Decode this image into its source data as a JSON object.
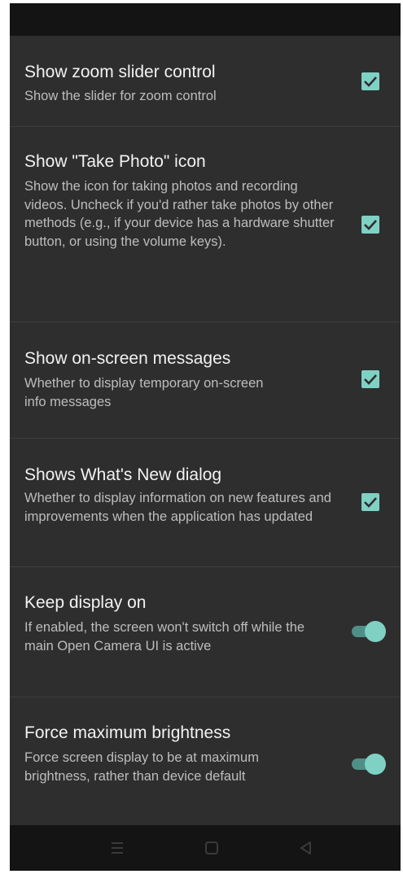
{
  "preferences": [
    {
      "title": "Show zoom slider control",
      "summary": "Show the slider for zoom control",
      "control": "checkbox",
      "checked": true
    },
    {
      "title": "Show \"Take Photo\" icon",
      "summary": "Show the icon for taking photos and recording videos. Uncheck if you'd rather take photos by other methods (e.g., if your device has a hardware shutter button, or using the volume keys).",
      "control": "checkbox",
      "checked": true
    },
    {
      "title": "Show on-screen messages",
      "summary": "Whether to display temporary on-screen info messages",
      "control": "checkbox",
      "checked": true
    },
    {
      "title": "Shows What's New dialog",
      "summary": "Whether to display information on new features and improvements when the application has updated",
      "control": "checkbox",
      "checked": true
    },
    {
      "title": "Keep display on",
      "summary": "If enabled, the screen won't switch off while the main Open Camera UI is active",
      "control": "toggle",
      "checked": true
    },
    {
      "title": "Force maximum brightness",
      "summary": "Force screen display to be at maximum brightness, rather than device default",
      "control": "toggle",
      "checked": true
    }
  ],
  "colors": {
    "background": "#2e2e2e",
    "system_bar": "#141414",
    "accent": "#7fd1c4",
    "title_text": "#f2f2f2",
    "summary_text": "#bdbdbd"
  },
  "nav_icons": [
    "menu-icon",
    "home-icon",
    "back-icon"
  ]
}
